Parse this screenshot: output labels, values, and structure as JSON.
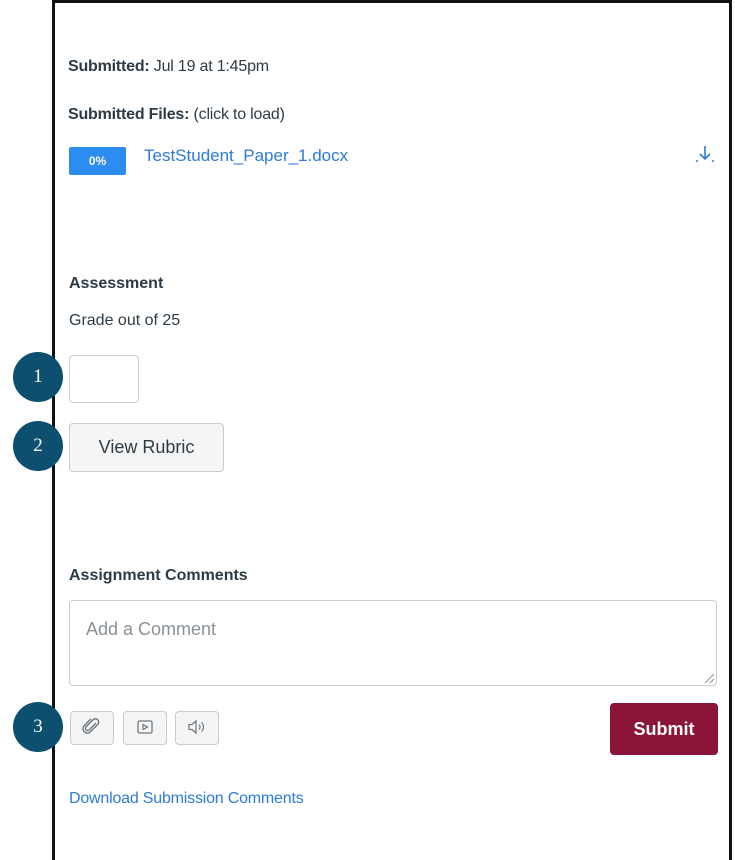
{
  "submission": {
    "submitted_label": "Submitted:",
    "submitted_value": " Jul 19 at 1:45pm",
    "files_label": "Submitted Files:",
    "files_hint": " (click to load)",
    "file": {
      "progress_badge": "0%",
      "name": "TestStudent_Paper_1.docx",
      "download_icon": "download-icon"
    }
  },
  "assessment": {
    "title": "Assessment",
    "grade_label": "Grade out of 25",
    "grade_value": "",
    "rubric_button": "View Rubric"
  },
  "comments": {
    "title": "Assignment Comments",
    "placeholder": "Add a Comment",
    "value": "",
    "tools": [
      {
        "icon": "paperclip-icon"
      },
      {
        "icon": "media-icon"
      },
      {
        "icon": "audio-icon"
      }
    ],
    "submit_label": "Submit",
    "download_link": "Download Submission Comments"
  },
  "markers": [
    "1",
    "2",
    "3"
  ],
  "colors": {
    "accent_blue": "#2d8cf0",
    "link_blue": "#2d7bd8",
    "submit_bg": "#8b1538",
    "marker_bg": "#0c4f6e"
  }
}
